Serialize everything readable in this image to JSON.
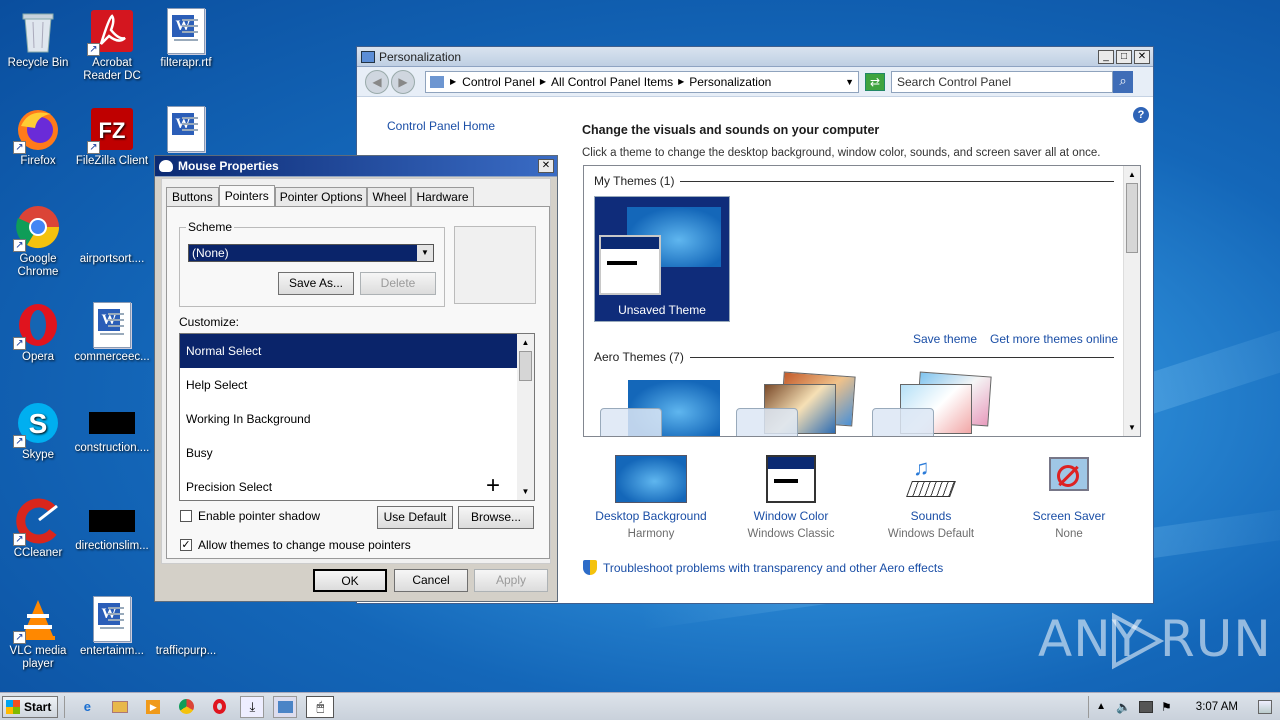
{
  "desktop": {
    "icons": [
      {
        "label": "Recycle Bin",
        "icon": "recycle-bin-icon"
      },
      {
        "label": "Acrobat Reader DC",
        "icon": "acrobat-icon"
      },
      {
        "label": "filterapr.rtf",
        "icon": "word-doc-icon"
      },
      {
        "label": "Firefox",
        "icon": "firefox-icon"
      },
      {
        "label": "FileZilla Client",
        "icon": "filezilla-icon"
      },
      {
        "label": "Google Chrome",
        "icon": "chrome-icon"
      },
      {
        "label": "airportsort....",
        "icon": "file-icon"
      },
      {
        "label": "Opera",
        "icon": "opera-icon"
      },
      {
        "label": "commerceec...",
        "icon": "word-doc-icon"
      },
      {
        "label": "Skype",
        "icon": "skype-icon"
      },
      {
        "label": "construction....",
        "icon": "file-icon"
      },
      {
        "label": "CCleaner",
        "icon": "ccleaner-icon"
      },
      {
        "label": "directionslim...",
        "icon": "file-icon"
      },
      {
        "label": "VLC media player",
        "icon": "vlc-icon"
      },
      {
        "label": "entertainm...",
        "icon": "word-doc-icon"
      },
      {
        "label": "trafficpurp...",
        "icon": "file-icon"
      }
    ],
    "watermark": "ANY RUN"
  },
  "personalization": {
    "title": "Personalization",
    "breadcrumb": [
      "Control Panel",
      "All Control Panel Items",
      "Personalization"
    ],
    "search_placeholder": "Search Control Panel",
    "sidebar_link": "Control Panel Home",
    "heading": "Change the visuals and sounds on your computer",
    "subheading": "Click a theme to change the desktop background, window color, sounds, and screen saver all at once.",
    "my_themes_label": "My Themes (1)",
    "unsaved_theme": "Unsaved Theme",
    "save_theme": "Save theme",
    "get_more": "Get more themes online",
    "aero_label": "Aero Themes (7)",
    "bottom_items": [
      {
        "label": "Desktop Background",
        "sub": "Harmony"
      },
      {
        "label": "Window Color",
        "sub": "Windows Classic"
      },
      {
        "label": "Sounds",
        "sub": "Windows Default"
      },
      {
        "label": "Screen Saver",
        "sub": "None"
      }
    ],
    "troubleshoot": "Troubleshoot problems with transparency and other Aero effects"
  },
  "mouse": {
    "title": "Mouse Properties",
    "tabs": [
      "Buttons",
      "Pointers",
      "Pointer Options",
      "Wheel",
      "Hardware"
    ],
    "scheme_label": "Scheme",
    "scheme_value": "(None)",
    "save_as": "Save As...",
    "delete": "Delete",
    "customize_label": "Customize:",
    "pointers": [
      "Normal Select",
      "Help Select",
      "Working In Background",
      "Busy",
      "Precision Select"
    ],
    "shadow_label": "Enable pointer shadow",
    "use_default": "Use Default",
    "browse": "Browse...",
    "allow_themes": "Allow themes to change mouse pointers",
    "ok": "OK",
    "cancel": "Cancel",
    "apply": "Apply"
  },
  "taskbar": {
    "start": "Start",
    "time": "3:07 AM"
  }
}
